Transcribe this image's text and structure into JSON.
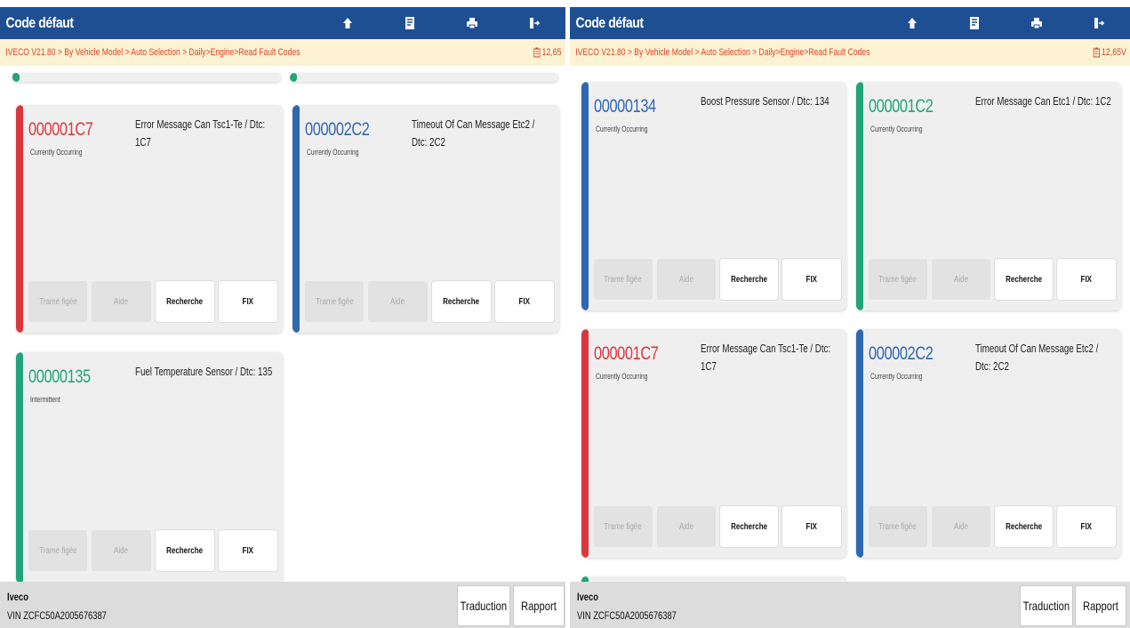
{
  "left_screen": {
    "header": {
      "title": "Code défaut",
      "icons": [
        "home-icon",
        "report-icon",
        "print-icon",
        "exit-icon"
      ]
    },
    "breadcrumb": "IVECO V21.80 > By Vehicle Model > Auto Selection > Daily>Engine>Read Fault Codes",
    "voltage": "12,65",
    "cards": [
      {
        "code": "000001C7",
        "description": "Error Message Can Tsc1-Te / Dtc: 1C7",
        "status": "Currently Occurring",
        "color": "#d9363e",
        "buttons": [
          "Trame figée",
          "Aide",
          "Recherche",
          "FIX"
        ]
      },
      {
        "code": "000002C2",
        "description": "Timeout Of Can Message Etc2 / Dtc: 2C2",
        "status": "Currently Occurring",
        "color": "#2f67b2",
        "buttons": [
          "Trame figée",
          "Aide",
          "Recherche",
          "FIX"
        ]
      },
      {
        "code": "00000135",
        "description": "Fuel Temperature Sensor / Dtc: 135",
        "status": "Intermittent",
        "color": "#20a47a",
        "buttons": [
          "Trame figée",
          "Aide",
          "Recherche",
          "FIX"
        ]
      }
    ],
    "footer": {
      "make": "Iveco",
      "vin": "VIN ZCFC50A2005676387",
      "buttons": [
        "Traduction",
        "Rapport"
      ]
    }
  },
  "right_screen": {
    "header": {
      "title": "Code défaut",
      "icons": [
        "home-icon",
        "report-icon",
        "print-icon",
        "exit-icon"
      ]
    },
    "breadcrumb": "IVECO V21.80 > By Vehicle Model > Auto Selection > Daily>Engine>Read Fault Codes",
    "voltage": "12,65V",
    "cards": [
      {
        "code": "00000134",
        "description": "Boost Pressure Sensor / Dtc: 134",
        "status": "Currently Occurring",
        "color": "#2f67b2",
        "buttons": [
          "Trame figée",
          "Aide",
          "Recherche",
          "FIX"
        ]
      },
      {
        "code": "000001C2",
        "description": "Error Message Can Etc1 / Dtc: 1C2",
        "status": "Currently Occurring",
        "color": "#20a47a",
        "buttons": [
          "Trame figée",
          "Aide",
          "Recherche",
          "FIX"
        ]
      },
      {
        "code": "000001C7",
        "description": "Error Message Can Tsc1-Te / Dtc: 1C7",
        "status": "Currently Occurring",
        "color": "#d9363e",
        "buttons": [
          "Trame figée",
          "Aide",
          "Recherche",
          "FIX"
        ]
      },
      {
        "code": "000002C2",
        "description": "Timeout Of Can Message Etc2 / Dtc: 2C2",
        "status": "Currently Occurring",
        "color": "#2f67b2",
        "buttons": [
          "Trame figée",
          "Aide",
          "Recherche",
          "FIX"
        ]
      }
    ],
    "footer": {
      "make": "Iveco",
      "vin": "VIN ZCFC50A2005676387",
      "buttons": [
        "Traduction",
        "Rapport"
      ]
    }
  }
}
